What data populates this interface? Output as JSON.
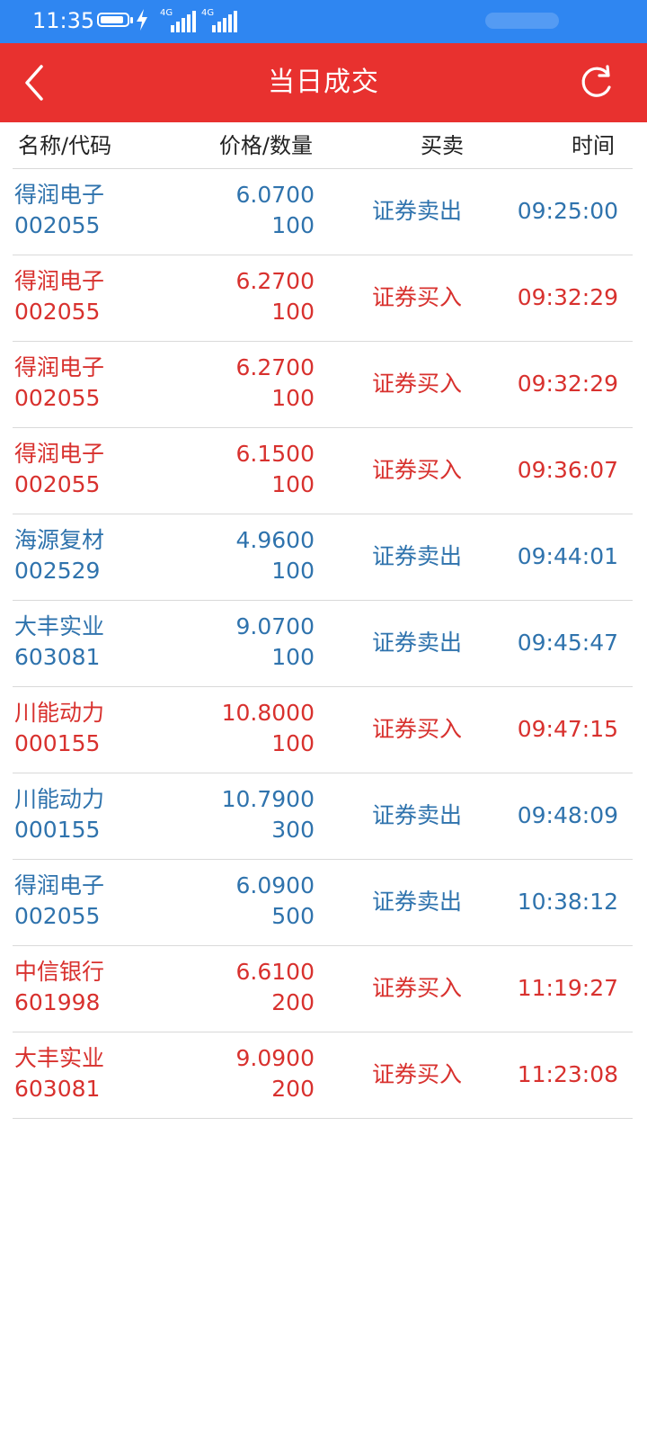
{
  "status_bar": {
    "time": "11:35",
    "battery_level": 0.9,
    "network_1": "4G",
    "network_2": "4G"
  },
  "header": {
    "title": "当日成交",
    "back_icon": "chevron-left-icon",
    "refresh_icon": "refresh-icon",
    "background": "#e8312f"
  },
  "columns": {
    "name_code": "名称/代码",
    "price_qty": "价格/数量",
    "side": "买卖",
    "time": "时间"
  },
  "colors": {
    "sell": "#2f73ad",
    "buy": "#d8312e"
  },
  "trades": [
    {
      "name": "得润电子",
      "code": "002055",
      "price": "6.0700",
      "qty": "100",
      "side": "证券卖出",
      "time": "09:25:00",
      "type": "sell"
    },
    {
      "name": "得润电子",
      "code": "002055",
      "price": "6.2700",
      "qty": "100",
      "side": "证券买入",
      "time": "09:32:29",
      "type": "buy"
    },
    {
      "name": "得润电子",
      "code": "002055",
      "price": "6.2700",
      "qty": "100",
      "side": "证券买入",
      "time": "09:32:29",
      "type": "buy"
    },
    {
      "name": "得润电子",
      "code": "002055",
      "price": "6.1500",
      "qty": "100",
      "side": "证券买入",
      "time": "09:36:07",
      "type": "buy"
    },
    {
      "name": "海源复材",
      "code": "002529",
      "price": "4.9600",
      "qty": "100",
      "side": "证券卖出",
      "time": "09:44:01",
      "type": "sell"
    },
    {
      "name": "大丰实业",
      "code": "603081",
      "price": "9.0700",
      "qty": "100",
      "side": "证券卖出",
      "time": "09:45:47",
      "type": "sell"
    },
    {
      "name": "川能动力",
      "code": "000155",
      "price": "10.8000",
      "qty": "100",
      "side": "证券买入",
      "time": "09:47:15",
      "type": "buy"
    },
    {
      "name": "川能动力",
      "code": "000155",
      "price": "10.7900",
      "qty": "300",
      "side": "证券卖出",
      "time": "09:48:09",
      "type": "sell"
    },
    {
      "name": "得润电子",
      "code": "002055",
      "price": "6.0900",
      "qty": "500",
      "side": "证券卖出",
      "time": "10:38:12",
      "type": "sell"
    },
    {
      "name": "中信银行",
      "code": "601998",
      "price": "6.6100",
      "qty": "200",
      "side": "证券买入",
      "time": "11:19:27",
      "type": "buy"
    },
    {
      "name": "大丰实业",
      "code": "603081",
      "price": "9.0900",
      "qty": "200",
      "side": "证券买入",
      "time": "11:23:08",
      "type": "buy"
    }
  ]
}
